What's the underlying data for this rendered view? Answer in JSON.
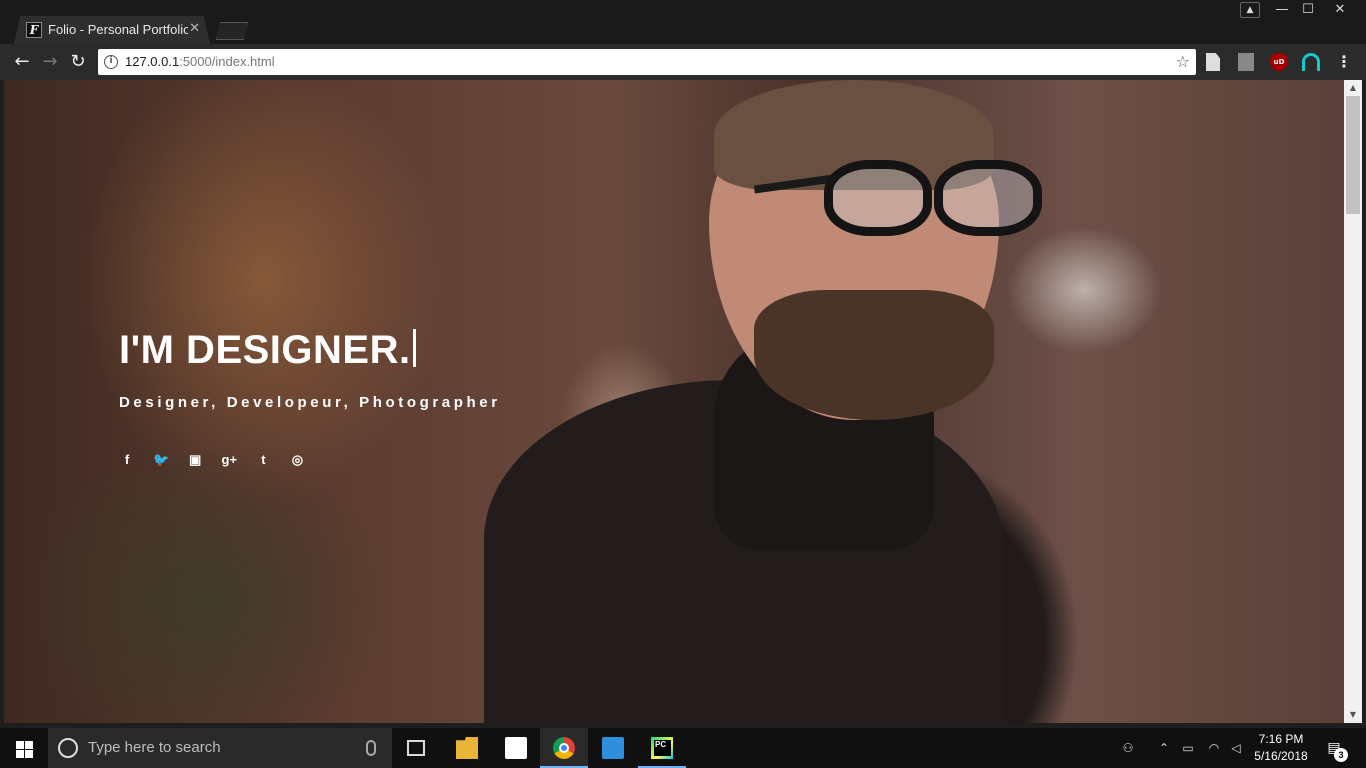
{
  "browser": {
    "tab": {
      "favicon_letter": "F",
      "title": "Folio - Personal Portfolio",
      "close_glyph": "✕"
    },
    "window_controls": {
      "minimize": "—",
      "maximize": "☐",
      "close": "✕"
    },
    "toolbar": {
      "back_glyph": "←",
      "forward_glyph": "→",
      "reload_glyph": "↻",
      "url_host": "127.0.0.1",
      "url_rest": ":5000/index.html",
      "star_glyph": "☆",
      "menu_glyph": "⋮",
      "extensions": [
        "document-icon",
        "pdf-icon",
        "ublock-icon",
        "arc-icon"
      ],
      "ublock_label": "uD"
    }
  },
  "hero": {
    "title": "I'M DESIGNER.",
    "subtitle": "Designer, Developeur, Photographer",
    "social": [
      {
        "name": "facebook-icon",
        "glyph": "f"
      },
      {
        "name": "twitter-icon",
        "glyph": "🐦"
      },
      {
        "name": "instagram-icon",
        "glyph": "▣"
      },
      {
        "name": "google-plus-icon",
        "glyph": "g+"
      },
      {
        "name": "tumblr-icon",
        "glyph": "t"
      },
      {
        "name": "dribbble-icon",
        "glyph": "◎"
      }
    ]
  },
  "taskbar": {
    "search_placeholder": "Type here to search",
    "apps": [
      "task-view",
      "file-explorer",
      "store",
      "chrome",
      "media-player",
      "pycharm"
    ],
    "time": "7:16 PM",
    "date": "5/16/2018",
    "notification_count": "3"
  },
  "colors": {
    "accent_taskbar": "#6cb4ff",
    "hero_text": "#ffffff"
  }
}
